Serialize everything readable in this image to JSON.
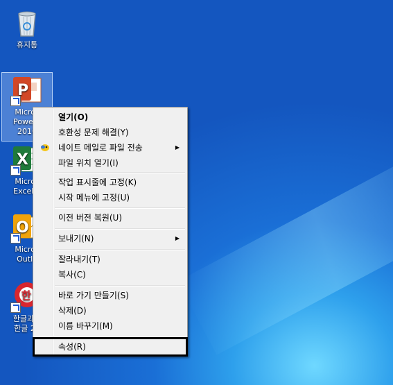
{
  "desktop": {
    "icons": [
      {
        "label": "휴지통"
      },
      {
        "label": "Micros\nPowerP\n2010"
      },
      {
        "label": "Micros\nExcel 2"
      },
      {
        "label": "Micros\nOutlo"
      },
      {
        "label": "한글과컴\n한글 20"
      }
    ]
  },
  "context_menu": {
    "groups": [
      [
        {
          "label": "열기(O)",
          "bold": true
        },
        {
          "label": "호환성 문제 해결(Y)"
        },
        {
          "label": "네이트 메일로 파일 전송",
          "submenu": true,
          "icon": "nate-mail-icon"
        },
        {
          "label": "파일 위치 열기(I)"
        }
      ],
      [
        {
          "label": "작업 표시줄에 고정(K)"
        },
        {
          "label": "시작 메뉴에 고정(U)"
        }
      ],
      [
        {
          "label": "이전 버전 복원(U)"
        }
      ],
      [
        {
          "label": "보내기(N)",
          "submenu": true
        }
      ],
      [
        {
          "label": "잘라내기(T)"
        },
        {
          "label": "복사(C)"
        }
      ],
      [
        {
          "label": "바로 가기 만들기(S)"
        },
        {
          "label": "삭제(D)"
        },
        {
          "label": "이름 바꾸기(M)"
        }
      ],
      [
        {
          "label": "속성(R)"
        }
      ]
    ]
  },
  "colors": {
    "desktop_blue": "#1a6fd6",
    "menu_bg": "#f0f0f0",
    "highlight_border": "#000000"
  }
}
